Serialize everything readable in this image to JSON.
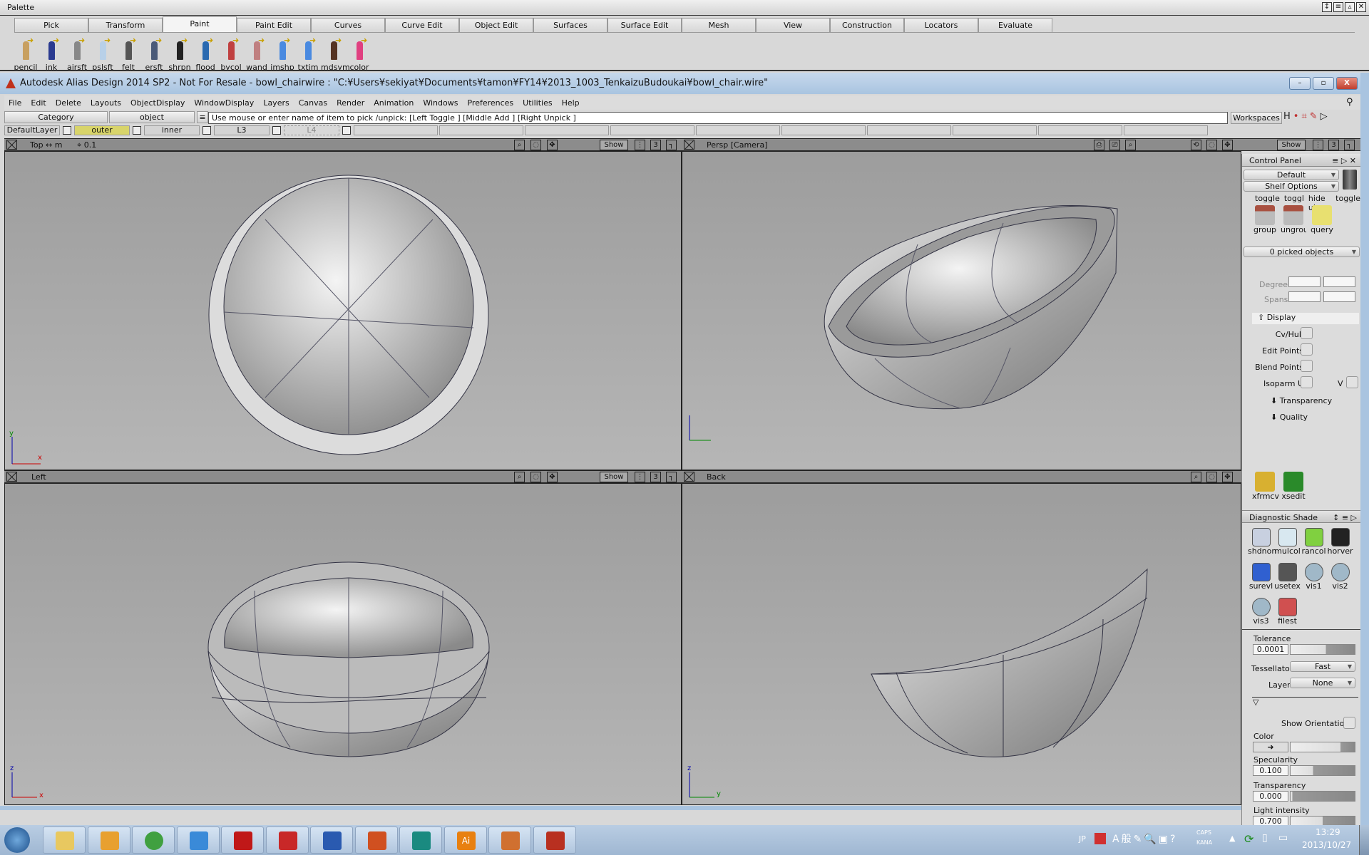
{
  "palette": {
    "title": "Palette",
    "tabs": [
      "Pick",
      "Transform",
      "Paint",
      "Paint Edit",
      "Curves",
      "Curve Edit",
      "Object Edit",
      "Surfaces",
      "Surface Edit",
      "Mesh",
      "View",
      "Construction",
      "Locators",
      "Evaluate"
    ],
    "active_tab": "Paint",
    "tools": [
      {
        "label": "pencil",
        "icon": "pencil-icon",
        "color": "#c8a060"
      },
      {
        "label": "ink",
        "icon": "ink-pen-icon",
        "color": "#2a3a90"
      },
      {
        "label": "airsft",
        "icon": "airbrush-icon",
        "color": "#888888"
      },
      {
        "label": "pslsft",
        "icon": "pastel-icon",
        "color": "#b8d0e8"
      },
      {
        "label": "felt",
        "icon": "felt-pen-icon",
        "color": "#555555"
      },
      {
        "label": "ersft",
        "icon": "eraser-icon",
        "color": "#4a5a78"
      },
      {
        "label": "shrpn",
        "icon": "sharpen-icon",
        "color": "#222222"
      },
      {
        "label": "flood",
        "icon": "flood-fill-icon",
        "color": "#2a6ab0"
      },
      {
        "label": "bycol",
        "icon": "by-color-icon",
        "color": "#c04040"
      },
      {
        "label": "wand",
        "icon": "wand-icon",
        "color": "#c08080"
      },
      {
        "label": "imshp",
        "icon": "image-shape-icon",
        "color": "#4a8ae0"
      },
      {
        "label": "txtim",
        "icon": "text-image-icon",
        "color": "#4a8ae0"
      },
      {
        "label": "mdsym",
        "icon": "mirror-symmetry-icon",
        "color": "#553322"
      },
      {
        "label": "color",
        "icon": "color-wheel-icon",
        "color": "#e04080"
      }
    ]
  },
  "window": {
    "title": "Autodesk Alias Design 2014 SP2 - Not For Resale   - bowl_chairwire : \"C:¥Users¥sekiyat¥Documents¥tamon¥FY14¥2013_1003_TenkaizuBudoukai¥bowl_chair.wire\""
  },
  "menu": [
    "File",
    "Edit",
    "Delete",
    "Layouts",
    "ObjectDisplay",
    "WindowDisplay",
    "Layers",
    "Canvas",
    "Render",
    "Animation",
    "Windows",
    "Preferences",
    "Utilities",
    "Help"
  ],
  "command": {
    "category": "Category",
    "object": "object",
    "prompt": "Use mouse or enter name of item to pick /unpick: [Left Toggle ] [Middle Add ] [Right Unpick ]",
    "workspaces": "Workspaces"
  },
  "layers": [
    {
      "name": "DefaultLayer",
      "color": "#d4d4d4"
    },
    {
      "name": "outer",
      "color": "#d8d46a"
    },
    {
      "name": "inner",
      "color": "#d4d4d4"
    },
    {
      "name": "L3",
      "color": "#d4d4d4"
    },
    {
      "name": "L4",
      "color": "#d4d4d4"
    }
  ],
  "viewports": {
    "top": {
      "title": "Top ↔ m",
      "grid": "0.1",
      "show": "Show",
      "num": "3",
      "ax1": "x",
      "ax2": "y"
    },
    "persp": {
      "title": "Persp [Camera]",
      "show": "Show",
      "num": "3"
    },
    "left": {
      "title": "Left",
      "show": "Show",
      "num": "3",
      "ax1": "x",
      "ax2": "z"
    },
    "back": {
      "title": "Back",
      "ax1": "y",
      "ax2": "z"
    }
  },
  "control_panel": {
    "title": "Control Panel",
    "preset": "Default",
    "shelf_options": "Shelf Options",
    "shelf_top": [
      "toggle",
      "toggl",
      "hide ui",
      "toggle"
    ],
    "shelf_items": [
      "group",
      "ungrou",
      "query"
    ],
    "picked": "0 picked objects",
    "degree": "Degree",
    "spans": "Spans",
    "display": "Display",
    "cv_hull": "Cv/Hull",
    "edit_points": "Edit Points",
    "blend_points": "Blend Points",
    "isoparm_u": "Isoparm U",
    "v": "V",
    "transparency": "Transparency",
    "quality": "Quality",
    "tools": [
      "xfrmcv",
      "xsedit"
    ]
  },
  "diagnostic": {
    "title": "Diagnostic Shade",
    "items": [
      {
        "label": "shdnon",
        "color": "#c8d0e0"
      },
      {
        "label": "mulcol",
        "color": "#d8e8f0"
      },
      {
        "label": "rancol",
        "color": "#80d040"
      },
      {
        "label": "horver",
        "color": "#222222"
      },
      {
        "label": "surevl",
        "color": "#3060d0"
      },
      {
        "label": "usetex",
        "color": "#555555"
      },
      {
        "label": "vis1",
        "color": "#a0b8c8"
      },
      {
        "label": "vis2",
        "color": "#a0b8c8"
      },
      {
        "label": "vis3",
        "color": "#a0b8c8"
      },
      {
        "label": "filest",
        "color": "#d05050"
      }
    ],
    "tolerance_label": "Tolerance",
    "tolerance": "0.0001",
    "tolerance_level": 0.55,
    "tessellator_label": "Tessellator",
    "tessellator": "Fast",
    "layer_label": "Layer",
    "layer": "None",
    "show_orientation": "Show Orientation",
    "color_label": "Color",
    "color_level": 0.78,
    "specularity_label": "Specularity",
    "specularity": "0.100",
    "specularity_level": 0.35,
    "transparency_label": "Transparency",
    "transparency": "0.000",
    "transparency_level": 0.03,
    "light_label": "Light intensity",
    "light": "0.700",
    "light_level": 0.5
  },
  "taskbar": {
    "apps": [
      {
        "name": "explorer",
        "color": "#e8c860"
      },
      {
        "name": "outlook",
        "color": "#e8a030"
      },
      {
        "name": "chrome",
        "color": "#40a040"
      },
      {
        "name": "internet-explorer",
        "color": "#3a8ad8"
      },
      {
        "name": "acrobat",
        "color": "#c01818"
      },
      {
        "name": "autocad-lt",
        "color": "#c82828"
      },
      {
        "name": "word",
        "color": "#2a5ab0"
      },
      {
        "name": "powerpoint",
        "color": "#d05020"
      },
      {
        "name": "alias",
        "color": "#1a8a80"
      },
      {
        "name": "illustrator",
        "color": "#e88010"
      },
      {
        "name": "sketchbook",
        "color": "#d07030"
      },
      {
        "name": "autocad",
        "color": "#b83020"
      }
    ],
    "ai_label": "Ai",
    "lang": "JP",
    "caps": "CAPS",
    "kana": "KANA",
    "time": "13:29",
    "date": "2013/10/27"
  }
}
